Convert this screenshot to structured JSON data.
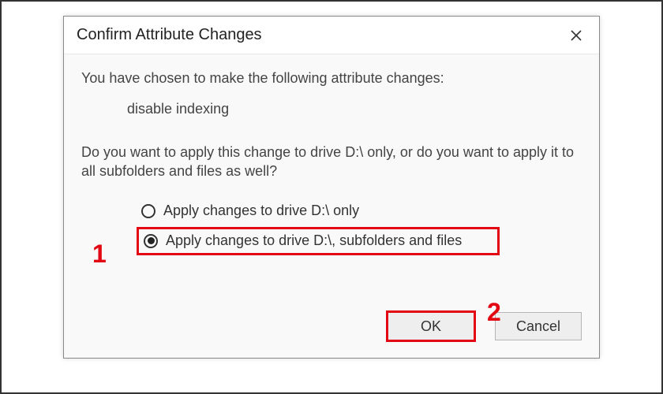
{
  "titlebar": {
    "title": "Confirm Attribute Changes"
  },
  "intro": "You have chosen to make the following attribute changes:",
  "change": "disable indexing",
  "question": "Do you want to apply this change to drive D:\\ only, or do you want to apply it to all subfolders and files as well?",
  "options": {
    "opt1_label": "Apply changes to drive D:\\ only",
    "opt2_label": "Apply changes to drive D:\\, subfolders and files",
    "selected": "opt2"
  },
  "buttons": {
    "ok": "OK",
    "cancel": "Cancel"
  },
  "annotations": {
    "one": "1",
    "two": "2"
  }
}
